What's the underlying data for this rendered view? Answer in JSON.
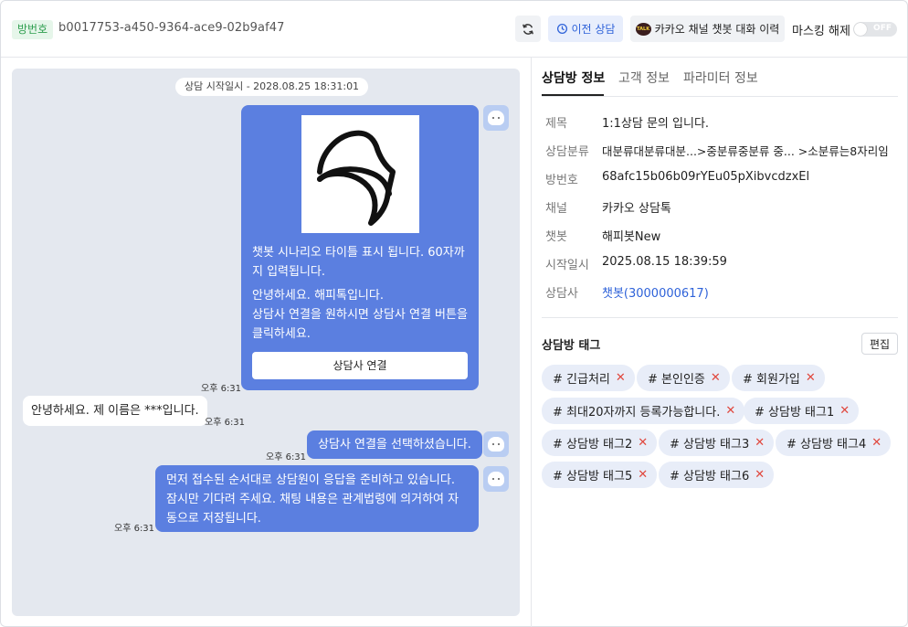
{
  "header": {
    "room_badge": "방번호",
    "room_id": "b0017753-a450-9364-ace9-02b9af47",
    "prev_consult_label": "이전 상담",
    "kakao_history_label": "카카오 채널 챗봇 대화 이력",
    "talk_icon_text": "TALK",
    "masking_label": "마스킹 해제",
    "toggle_text": "OFF"
  },
  "chat": {
    "start_pill": "상담 시작일시 - 2028.08.25 18:31:01",
    "card": {
      "title": "챗봇 시나리오 타이틀 표시 됩니다. 60자까지 입력됩니다.",
      "body_line1": "안녕하세요. 해피톡입니다.",
      "body_line2": "상담사 연결을 원하시면 상담사 연결 버튼을 클릭하세요.",
      "button": "상담사 연결",
      "time": "오후 6:31"
    },
    "user_msg": {
      "text": "안녕하세요. 제 이름은 ***입니다.",
      "time": "오후 6:31"
    },
    "bot_msg2": {
      "text": "상담사 연결을 선택하셨습니다.",
      "time": "오후 6:31"
    },
    "bot_msg3": {
      "text": "먼저 접수된 순서대로 상담원이 응답을 준비하고 있습니다. 잠시만 기다려 주세요. 채팅 내용은 관계법령에 의거하여 자동으로 저장됩니다.",
      "time": "오후 6:31"
    }
  },
  "tabs": [
    "상담방 정보",
    "고객 정보",
    "파라미터 정보"
  ],
  "info": [
    {
      "label": "제목",
      "value": "1:1상담 문의 입니다."
    },
    {
      "label": "상담분류",
      "value": "대분류대분류대분...>중분류중분류 중...  >소분류는8자리임"
    },
    {
      "label": "방번호",
      "value": "68afc15b06b09rYEu05pXibvcdzxEl"
    },
    {
      "label": "채널",
      "value": "카카오 상담톡"
    },
    {
      "label": "챗봇",
      "value": "해피봇New"
    },
    {
      "label": "시작일시",
      "value": "2025.08.15 18:39:59"
    },
    {
      "label": "상담사",
      "value": "챗봇(3000000617)"
    }
  ],
  "tags_section": {
    "title": "상담방 태그",
    "edit_label": "편집",
    "remove_glyph": "✕",
    "tags": [
      "# 긴급처리",
      "# 본인인증",
      "# 회원가입",
      "# 최대20자까지 등록가능합니다.",
      "# 상담방 태그1",
      "# 상담방 태그2",
      "# 상담방 태그3",
      "# 상담방 태그4",
      "# 상담방 태그5",
      "# 상담방 태그6"
    ]
  },
  "colors": {
    "accent": "#2e62d9",
    "bot_bubble": "#5b7fe0",
    "chat_bg": "#e4e8ef",
    "tag_bg": "#e8edf8",
    "remove": "#e0473d"
  }
}
